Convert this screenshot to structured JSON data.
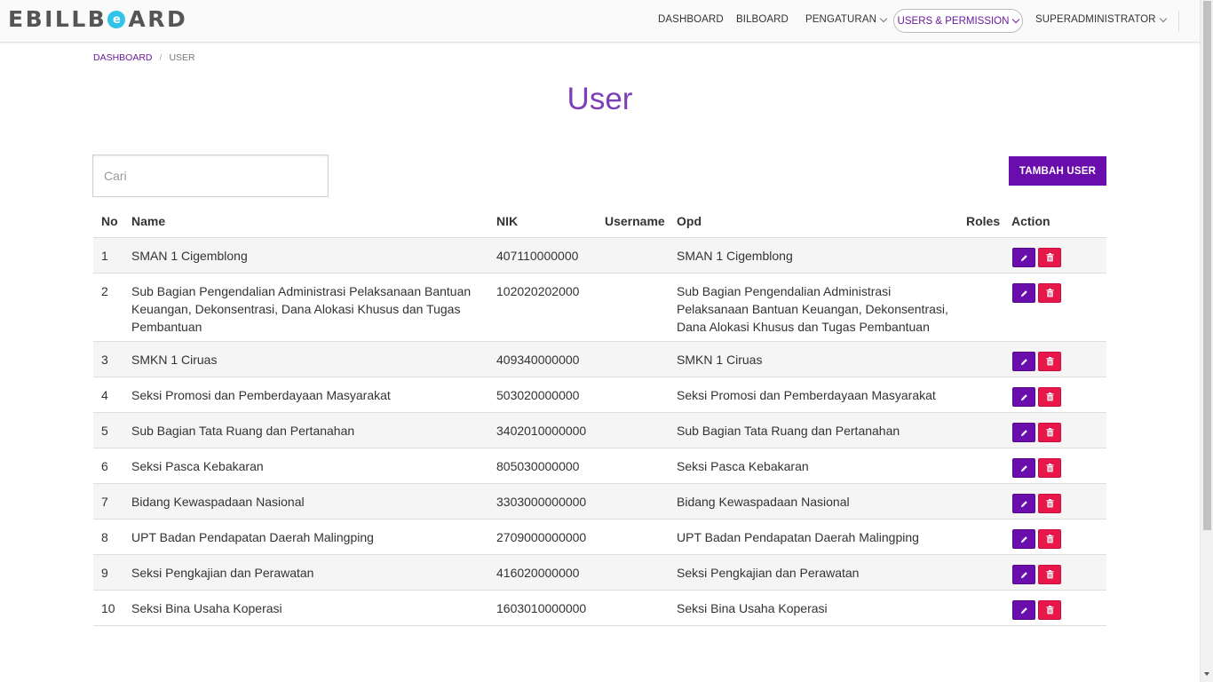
{
  "brand": {
    "logo_left": "EBILLB",
    "logo_mark": "e",
    "logo_right": "ARD"
  },
  "nav": {
    "dashboard": "DASHBOARD",
    "bilboard": "BILBOARD",
    "pengaturan": "PENGATURAN",
    "users_permission": "USERS & PERMISSION",
    "user_menu": "SUPERADMINISTRATOR"
  },
  "breadcrumb": {
    "home": "DASHBOARD",
    "separator": "/",
    "current": "USER"
  },
  "page": {
    "title": "User",
    "search_placeholder": "Cari",
    "search_value": "",
    "add_button": "TAMBAH USER"
  },
  "table": {
    "headers": {
      "no": "No",
      "name": "Name",
      "nik": "NIK",
      "username": "Username",
      "opd": "Opd",
      "roles": "Roles",
      "action": "Action"
    },
    "rows": [
      {
        "no": "1",
        "name": "SMAN 1 Cigemblong",
        "nik": "407110000000",
        "username": "",
        "opd": "SMAN 1 Cigemblong",
        "roles": ""
      },
      {
        "no": "2",
        "name": "Sub Bagian Pengendalian Administrasi Pelaksanaan Bantuan Keuangan, Dekonsentrasi, Dana Alokasi Khusus dan Tugas Pembantuan",
        "nik": "102020202000",
        "username": "",
        "opd": "Sub Bagian Pengendalian Administrasi Pelaksanaan Bantuan Keuangan, Dekonsentrasi, Dana Alokasi Khusus dan Tugas Pembantuan",
        "roles": ""
      },
      {
        "no": "3",
        "name": "SMKN 1 Ciruas",
        "nik": "409340000000",
        "username": "",
        "opd": "SMKN 1 Ciruas",
        "roles": ""
      },
      {
        "no": "4",
        "name": "Seksi Promosi dan Pemberdayaan Masyarakat",
        "nik": "503020000000",
        "username": "",
        "opd": "Seksi Promosi dan Pemberdayaan Masyarakat",
        "roles": ""
      },
      {
        "no": "5",
        "name": "Sub Bagian Tata Ruang dan Pertanahan",
        "nik": "3402010000000",
        "username": "",
        "opd": "Sub Bagian Tata Ruang dan Pertanahan",
        "roles": ""
      },
      {
        "no": "6",
        "name": "Seksi Pasca Kebakaran",
        "nik": "805030000000",
        "username": "",
        "opd": "Seksi Pasca Kebakaran",
        "roles": ""
      },
      {
        "no": "7",
        "name": "Bidang Kewaspadaan Nasional",
        "nik": "3303000000000",
        "username": "",
        "opd": "Bidang Kewaspadaan Nasional",
        "roles": ""
      },
      {
        "no": "8",
        "name": "UPT Badan Pendapatan Daerah Malingping",
        "nik": "2709000000000",
        "username": "",
        "opd": "UPT Badan Pendapatan Daerah Malingping",
        "roles": ""
      },
      {
        "no": "9",
        "name": "Seksi Pengkajian dan Perawatan",
        "nik": "416020000000",
        "username": "",
        "opd": "Seksi Pengkajian dan Perawatan",
        "roles": ""
      },
      {
        "no": "10",
        "name": "Seksi Bina Usaha Koperasi",
        "nik": "1603010000000",
        "username": "",
        "opd": "Seksi Bina Usaha Koperasi",
        "roles": ""
      }
    ]
  },
  "icons": {
    "edit": "pencil-icon",
    "delete": "trash-icon",
    "dropdown": "chevron-down-icon"
  },
  "colors": {
    "primary": "#6a0dad",
    "danger": "#e8174a",
    "title": "#7b3fb8",
    "brand_accent": "#31c4e9"
  }
}
